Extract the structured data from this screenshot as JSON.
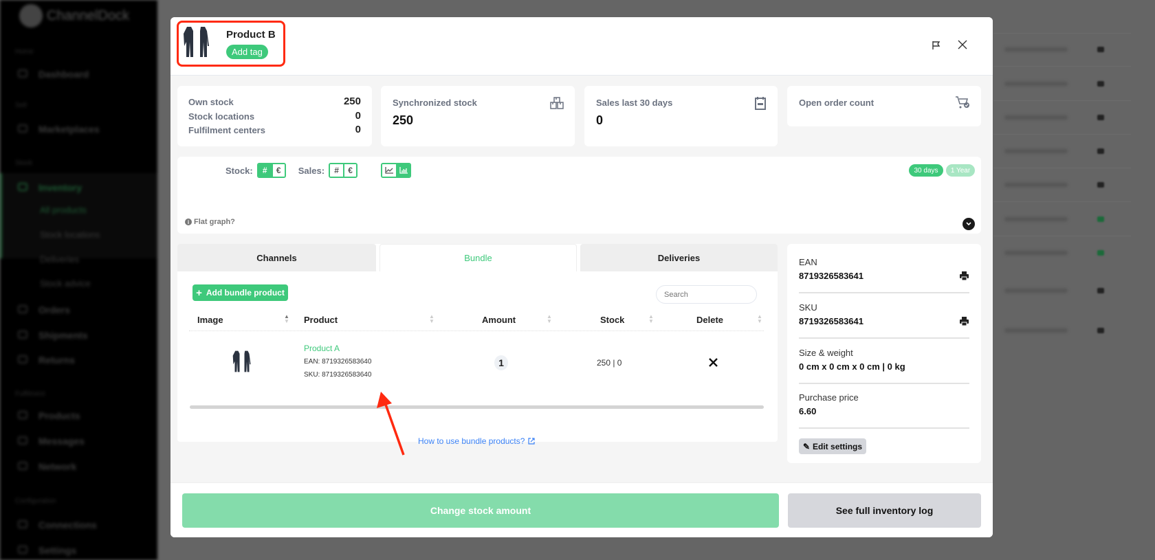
{
  "background": {
    "brand": "ChannelDock",
    "sidebar": {
      "sections": [
        "Home",
        "Sell",
        "Stock",
        "Fulfilment",
        "Configuration"
      ],
      "items": [
        "Dashboard",
        "Marketplaces",
        "Inventory",
        "Orders",
        "Shipments",
        "Returns",
        "Products",
        "Messages",
        "Network",
        "Connections",
        "Settings"
      ],
      "subitems": [
        "All products",
        "Stock locations",
        "Deliveries",
        "Stock advice"
      ]
    }
  },
  "modal": {
    "product_title": "Product B",
    "add_tag_label": "Add tag",
    "stats": {
      "own_stock_label": "Own stock",
      "own_stock_value": "250",
      "stock_locations_label": "Stock locations",
      "stock_locations_value": "0",
      "fulfilment_centers_label": "Fulfilment centers",
      "fulfilment_centers_value": "0",
      "synchronized_stock_label": "Synchronized stock",
      "synchronized_stock_value": "250",
      "sales_30_label": "Sales last 30 days",
      "sales_30_value": "0",
      "open_order_label": "Open order count"
    },
    "graph": {
      "stock_label": "Stock:",
      "sales_label": "Sales:",
      "hash": "#",
      "euro": "€",
      "range_30": "30 days",
      "range_year": "1 Year",
      "flat_graph": "Flat graph?"
    },
    "tabs": [
      {
        "label": "Channels"
      },
      {
        "label": "Bundle",
        "active": true
      },
      {
        "label": "Deliveries"
      }
    ],
    "bundle": {
      "add_button": "Add bundle product",
      "search_placeholder": "Search",
      "columns": [
        "Image",
        "Product",
        "Amount",
        "Stock",
        "Delete"
      ],
      "rows": [
        {
          "product": "Product A",
          "ean": "EAN: 8719326583640",
          "sku": "SKU: 8719326583640",
          "amount": "1",
          "stock": "250 | 0"
        }
      ],
      "help_link": "How to use bundle products?"
    },
    "info": {
      "ean_label": "EAN",
      "ean_value": "8719326583641",
      "sku_label": "SKU",
      "sku_value": "8719326583641",
      "size_label": "Size & weight",
      "size_value": "0 cm x 0 cm x 0 cm | 0 kg",
      "price_label": "Purchase price",
      "price_value": "6.60",
      "edit_button": "Edit settings"
    },
    "footer": {
      "change_stock": "Change stock amount",
      "full_log": "See full inventory log"
    }
  },
  "colors": {
    "accent": "#3ec97b",
    "link": "#3b82f6",
    "annotation": "#ff2a10"
  }
}
